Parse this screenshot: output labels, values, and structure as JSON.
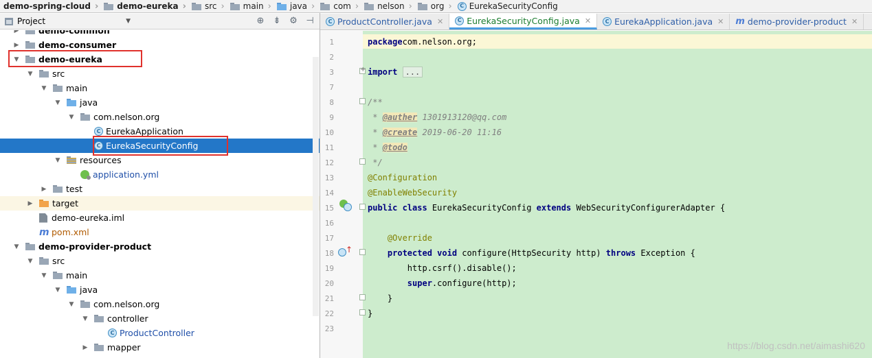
{
  "breadcrumb": [
    {
      "label": "demo-spring-cloud",
      "bold": true,
      "icon": "none"
    },
    {
      "label": "demo-eureka",
      "bold": true,
      "icon": "module-folder-icon"
    },
    {
      "label": "src",
      "bold": false,
      "icon": "folder-icon"
    },
    {
      "label": "main",
      "bold": false,
      "icon": "folder-icon"
    },
    {
      "label": "java",
      "bold": false,
      "icon": "source-folder-icon"
    },
    {
      "label": "com",
      "bold": false,
      "icon": "folder-icon"
    },
    {
      "label": "nelson",
      "bold": false,
      "icon": "folder-icon"
    },
    {
      "label": "org",
      "bold": false,
      "icon": "folder-icon"
    },
    {
      "label": "EurekaSecurityConfig",
      "bold": false,
      "icon": "class-icon"
    }
  ],
  "project_panel": {
    "title": "Project"
  },
  "tree": [
    {
      "label": "demo-common",
      "indent": 1,
      "arrow": "closed",
      "bold": true,
      "icon": "module"
    },
    {
      "label": "demo-consumer",
      "indent": 1,
      "arrow": "closed",
      "bold": true,
      "icon": "module"
    },
    {
      "label": "demo-eureka",
      "indent": 1,
      "arrow": "open",
      "bold": true,
      "icon": "module"
    },
    {
      "label": "src",
      "indent": 2,
      "arrow": "open",
      "icon": "folder"
    },
    {
      "label": "main",
      "indent": 3,
      "arrow": "open",
      "icon": "folder"
    },
    {
      "label": "java",
      "indent": 4,
      "arrow": "open",
      "icon": "source"
    },
    {
      "label": "com.nelson.org",
      "indent": 5,
      "arrow": "open",
      "icon": "package"
    },
    {
      "label": "EurekaApplication",
      "indent": 6,
      "arrow": "none",
      "icon": "class"
    },
    {
      "label": "EurekaSecurityConfig",
      "indent": 6,
      "arrow": "none",
      "icon": "class",
      "selected": true
    },
    {
      "label": "resources",
      "indent": 4,
      "arrow": "open",
      "icon": "resources"
    },
    {
      "label": "application.yml",
      "indent": 5,
      "arrow": "none",
      "icon": "yml",
      "color": "blue"
    },
    {
      "label": "test",
      "indent": 3,
      "arrow": "closed",
      "icon": "folder"
    },
    {
      "label": "target",
      "indent": 2,
      "arrow": "closed",
      "icon": "target",
      "excluded": true
    },
    {
      "label": "demo-eureka.iml",
      "indent": 2,
      "arrow": "none",
      "icon": "iml"
    },
    {
      "label": "pom.xml",
      "indent": 2,
      "arrow": "none",
      "icon": "pom",
      "color": "orange"
    },
    {
      "label": "demo-provider-product",
      "indent": 1,
      "arrow": "open",
      "bold": true,
      "icon": "module"
    },
    {
      "label": "src",
      "indent": 2,
      "arrow": "open",
      "icon": "folder"
    },
    {
      "label": "main",
      "indent": 3,
      "arrow": "open",
      "icon": "folder"
    },
    {
      "label": "java",
      "indent": 4,
      "arrow": "open",
      "icon": "source"
    },
    {
      "label": "com.nelson.org",
      "indent": 5,
      "arrow": "open",
      "icon": "package"
    },
    {
      "label": "controller",
      "indent": 6,
      "arrow": "open",
      "icon": "package"
    },
    {
      "label": "ProductController",
      "indent": 7,
      "arrow": "none",
      "icon": "class",
      "color": "blue"
    },
    {
      "label": "mapper",
      "indent": 6,
      "arrow": "closed",
      "icon": "package"
    }
  ],
  "tabs": [
    {
      "label": "ProductController.java",
      "icon": "class-icon",
      "active": false
    },
    {
      "label": "EurekaSecurityConfig.java",
      "icon": "class-icon",
      "active": true
    },
    {
      "label": "EurekaApplication.java",
      "icon": "class-icon",
      "active": false
    },
    {
      "label": "demo-provider-product",
      "icon": "maven-icon",
      "active": false
    }
  ],
  "code": [
    {
      "n": "1",
      "parts": [
        [
          "kw",
          "package"
        ],
        [
          "",
          "com.nelson.org;"
        ]
      ]
    },
    {
      "n": "2",
      "parts": []
    },
    {
      "n": "3",
      "parts": [
        [
          "kw",
          "import "
        ],
        [
          "folded",
          "..."
        ]
      ]
    },
    {
      "n": "7",
      "parts": []
    },
    {
      "n": "8",
      "parts": [
        [
          "cmt",
          "/**"
        ]
      ]
    },
    {
      "n": "9",
      "parts": [
        [
          "cmt",
          " * "
        ],
        [
          "tag",
          "@auther"
        ],
        [
          "cmt",
          " 1301913120@qq.com"
        ]
      ]
    },
    {
      "n": "10",
      "parts": [
        [
          "cmt",
          " * "
        ],
        [
          "tag",
          "@create"
        ],
        [
          "cmt",
          " 2019-06-20 11:16"
        ]
      ]
    },
    {
      "n": "11",
      "parts": [
        [
          "cmt",
          " * "
        ],
        [
          "tag",
          "@todo"
        ]
      ]
    },
    {
      "n": "12",
      "parts": [
        [
          "cmt",
          " */"
        ]
      ]
    },
    {
      "n": "13",
      "parts": [
        [
          "ann",
          "@Configuration"
        ]
      ]
    },
    {
      "n": "14",
      "parts": [
        [
          "ann",
          "@EnableWebSecurity"
        ]
      ]
    },
    {
      "n": "15",
      "parts": [
        [
          "kw",
          "public class "
        ],
        [
          "",
          "EurekaSecurityConfig "
        ],
        [
          "kw",
          "extends "
        ],
        [
          "",
          "WebSecurityConfigurerAdapter {"
        ]
      ]
    },
    {
      "n": "16",
      "parts": []
    },
    {
      "n": "17",
      "parts": [
        [
          "",
          "    "
        ],
        [
          "ann",
          "@Override"
        ]
      ]
    },
    {
      "n": "18",
      "parts": [
        [
          "",
          "    "
        ],
        [
          "kw",
          "protected void "
        ],
        [
          "",
          "configure(HttpSecurity http) "
        ],
        [
          "kw",
          "throws "
        ],
        [
          "",
          "Exception {"
        ]
      ]
    },
    {
      "n": "19",
      "parts": [
        [
          "",
          "        http.csrf().disable();"
        ]
      ]
    },
    {
      "n": "20",
      "parts": [
        [
          "",
          "        "
        ],
        [
          "kw",
          "super"
        ],
        [
          "",
          ".configure(http);"
        ]
      ]
    },
    {
      "n": "21",
      "parts": [
        [
          "",
          "    }"
        ]
      ]
    },
    {
      "n": "22",
      "parts": [
        [
          "",
          "}"
        ]
      ]
    },
    {
      "n": "23",
      "parts": []
    }
  ],
  "watermark": "https://blog.csdn.net/aimashi620",
  "colors": {
    "selection": "#2377c8",
    "editor_bg": "#cdeccd",
    "highlight_box": "#e0312c",
    "keyword": "#000080",
    "annotation": "#808000"
  }
}
